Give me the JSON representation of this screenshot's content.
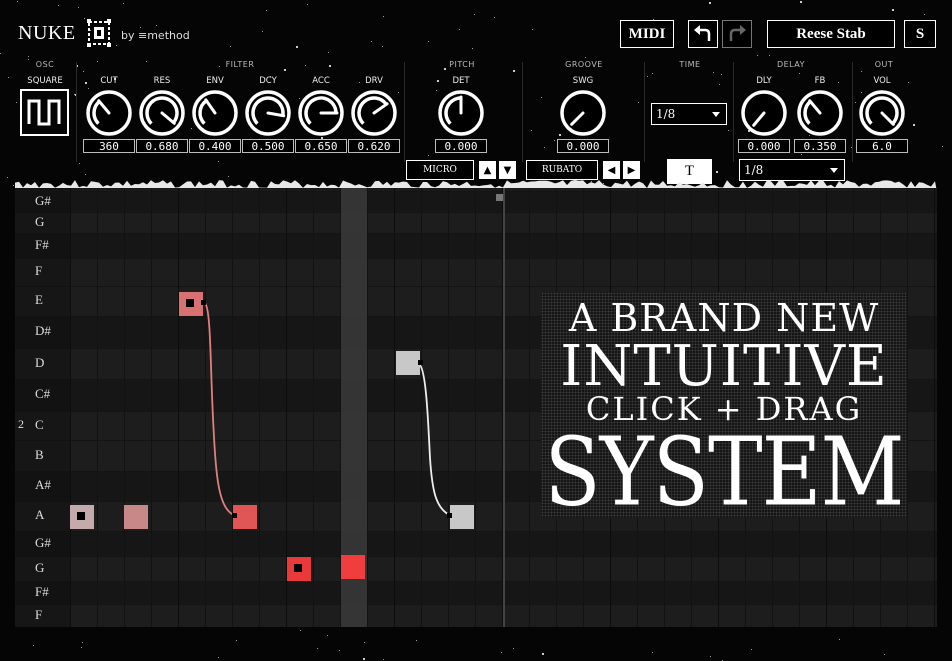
{
  "header": {
    "app_name": "NUKE",
    "byline": "by ≡method",
    "midi_label": "MIDI",
    "undo_icon": "undo-icon",
    "redo_icon": "redo-icon",
    "preset_name": "Reese Stab",
    "s_label": "S"
  },
  "sections": {
    "osc": "OSC",
    "filter": "FILTER",
    "pitch": "PITCH",
    "groove": "GROOVE",
    "time": "TIME",
    "delay": "DELAY",
    "out": "OUT"
  },
  "osc": {
    "wave_label": "SQUARE",
    "wave_icon": "square-wave-icon"
  },
  "knobs": [
    {
      "label": "CUT",
      "value": "360"
    },
    {
      "label": "RES",
      "value": "0.680"
    },
    {
      "label": "ENV",
      "value": "0.400"
    },
    {
      "label": "DCY",
      "value": "0.500"
    },
    {
      "label": "ACC",
      "value": "0.650"
    },
    {
      "label": "DRV",
      "value": "0.620"
    },
    {
      "label": "DET",
      "value": "0.000"
    },
    {
      "label": "SWG",
      "value": "0.000"
    },
    {
      "label": "DLY",
      "value": "0.000"
    },
    {
      "label": "FB",
      "value": "0.350"
    },
    {
      "label": "VOL",
      "value": "6.0"
    }
  ],
  "pitch": {
    "micro_label": "MICRO",
    "up_icon": "triangle-up-icon",
    "down_icon": "triangle-down-icon"
  },
  "groove": {
    "rubato_label": "RUBATO",
    "left_icon": "triangle-left-icon",
    "right_icon": "triangle-right-icon"
  },
  "time": {
    "division": "1/8",
    "tab_label": "T"
  },
  "delay": {
    "division": "1/8"
  },
  "grid": {
    "note_names": [
      "G#",
      "G",
      "F#",
      "F",
      "E",
      "D#",
      "D",
      "C#",
      "C",
      "B",
      "A#",
      "A",
      "G#",
      "G",
      "F#",
      "F"
    ],
    "octave_label": "2"
  },
  "banner": {
    "line1": "A BRAND NEW",
    "line2": "INTUITIVE",
    "line3": "CLICK + DRAG",
    "line4": "SYSTEM"
  },
  "colors": {
    "accent_red": "#e83a3a",
    "note_pink": "#d87272",
    "note_light_pink": "#c88888",
    "note_grey": "#c8c8c8",
    "note_lilac": "#c4aaaa",
    "playhead": "#3a3a3a"
  }
}
